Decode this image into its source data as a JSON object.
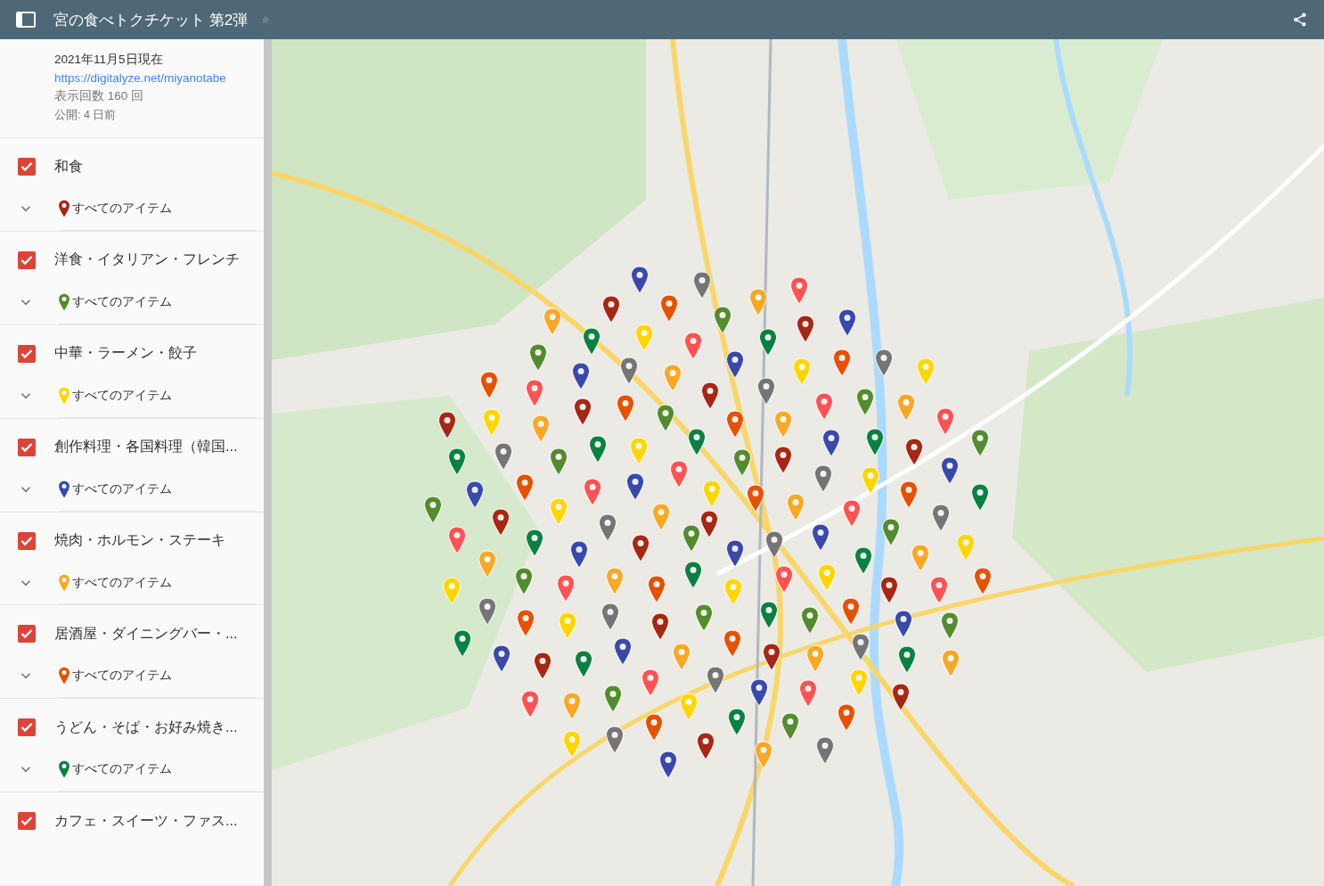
{
  "header": {
    "title": "宮の食べトクチケット 第2弾",
    "starred": false
  },
  "info": {
    "date": "2021年11月5日現在",
    "link": "https://digitalyze.net/miyanotabe",
    "views": "表示回数 160 回",
    "published": "公開: 4 日前"
  },
  "layers": [
    {
      "name": "和食",
      "checked": true,
      "items_label": "すべてのアイテム",
      "color": "#a52714"
    },
    {
      "name": "洋食・イタリアン・フレンチ",
      "checked": true,
      "items_label": "すべてのアイテム",
      "color": "#558b2f"
    },
    {
      "name": "中華・ラーメン・餃子",
      "checked": true,
      "items_label": "すべてのアイテム",
      "color": "#ffd600"
    },
    {
      "name": "創作料理・各国料理（韓国...",
      "checked": true,
      "items_label": "すべてのアイテム",
      "color": "#3949ab"
    },
    {
      "name": "焼肉・ホルモン・ステーキ",
      "checked": true,
      "items_label": "すべてのアイテム",
      "color": "#f9a825"
    },
    {
      "name": "居酒屋・ダイニングバー・...",
      "checked": true,
      "items_label": "すべてのアイテム",
      "color": "#e65100"
    },
    {
      "name": "うどん・そば・お好み焼き...",
      "checked": true,
      "items_label": "すべてのアイテム",
      "color": "#0b8043"
    },
    {
      "name": "カフェ・スイーツ・ファス...",
      "checked": true
    }
  ]
}
